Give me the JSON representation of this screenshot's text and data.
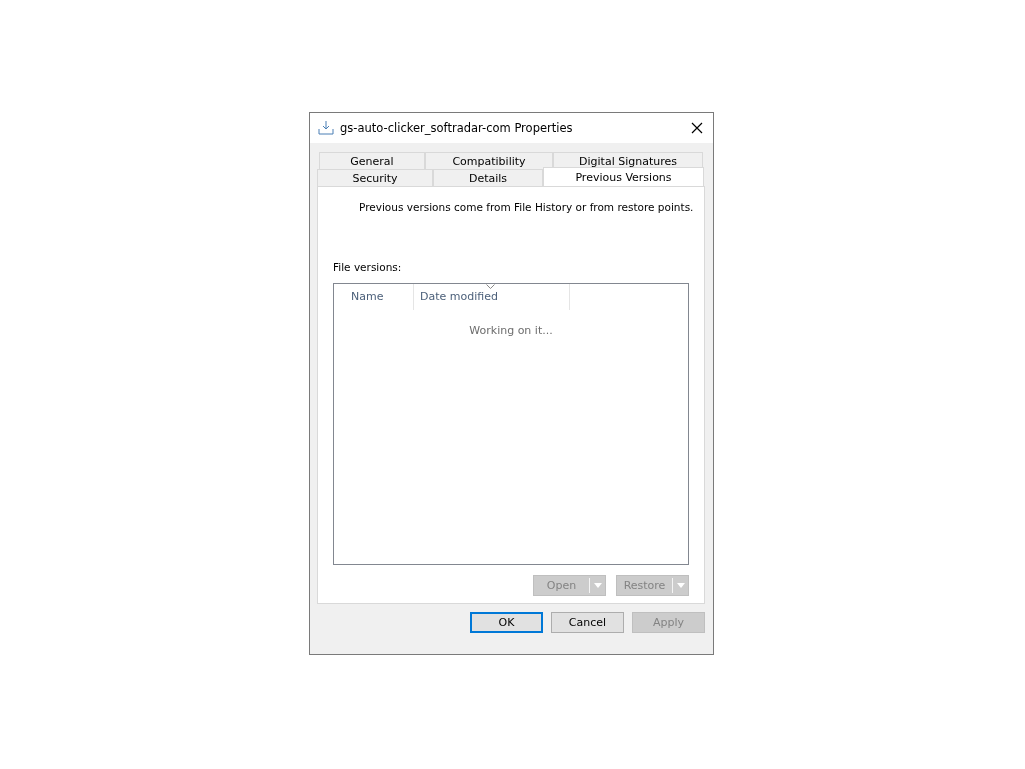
{
  "window": {
    "title": "gs-auto-clicker_softradar-com Properties"
  },
  "tab_rows": [
    [
      {
        "label": "General",
        "selected": false
      },
      {
        "label": "Compatibility",
        "selected": false
      },
      {
        "label": "Digital Signatures",
        "selected": false
      }
    ],
    [
      {
        "label": "Security",
        "selected": false
      },
      {
        "label": "Details",
        "selected": false
      },
      {
        "label": "Previous Versions",
        "selected": true
      }
    ]
  ],
  "info": "Previous versions come from File History or from restore points.",
  "file_versions": {
    "label": "File versions:",
    "columns": [
      {
        "label": "Name",
        "sorted": false
      },
      {
        "label": "Date modified",
        "sorted": true
      }
    ],
    "status": "Working on it..."
  },
  "split_buttons": [
    {
      "label": "Open",
      "disabled": true
    },
    {
      "label": "Restore",
      "disabled": true
    }
  ],
  "buttons": [
    {
      "label": "OK",
      "default": true,
      "disabled": false
    },
    {
      "label": "Cancel",
      "default": false,
      "disabled": false
    },
    {
      "label": "Apply",
      "default": false,
      "disabled": true
    }
  ]
}
